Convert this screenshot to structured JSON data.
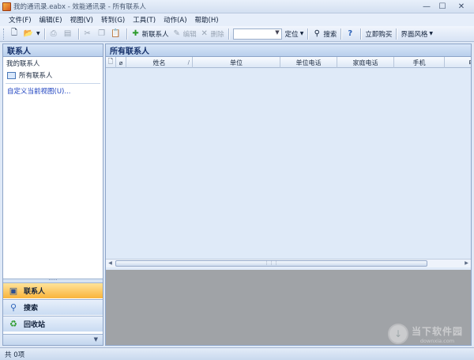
{
  "window": {
    "title": "我的通讯录.eabx - 效能通讯录 - 所有联系人",
    "min": "—",
    "max": "☐",
    "close": "✕"
  },
  "menu": [
    "文件(F)",
    "编辑(E)",
    "视图(V)",
    "转到(G)",
    "工具(T)",
    "动作(A)",
    "帮助(H)"
  ],
  "toolbar": {
    "new_contact": "新联系人",
    "edit": "编辑",
    "delete": "删除",
    "locate": "定位",
    "search": "搜索",
    "buy_now": "立即购买",
    "ui_style": "界面风格",
    "combo_value": ""
  },
  "left_pane": {
    "header": "联系人",
    "group_label": "我的联系人",
    "tree_items": [
      "所有联系人"
    ],
    "custom_view_link": "自定义当前视图(U)...",
    "nav_buttons": [
      "联系人",
      "搜索",
      "回收站"
    ]
  },
  "right_pane": {
    "header": "所有联系人",
    "columns": [
      "姓名",
      "单位",
      "单位电话",
      "家庭电话",
      "手机",
      "电"
    ],
    "rows": []
  },
  "status": {
    "text": "共 0项"
  },
  "watermark": {
    "cn": "当下软件园",
    "en": "downxia.com"
  },
  "colors": {
    "accent_active": "#f9b43c",
    "header_text": "#15306a",
    "link": "#1a3fbf"
  }
}
